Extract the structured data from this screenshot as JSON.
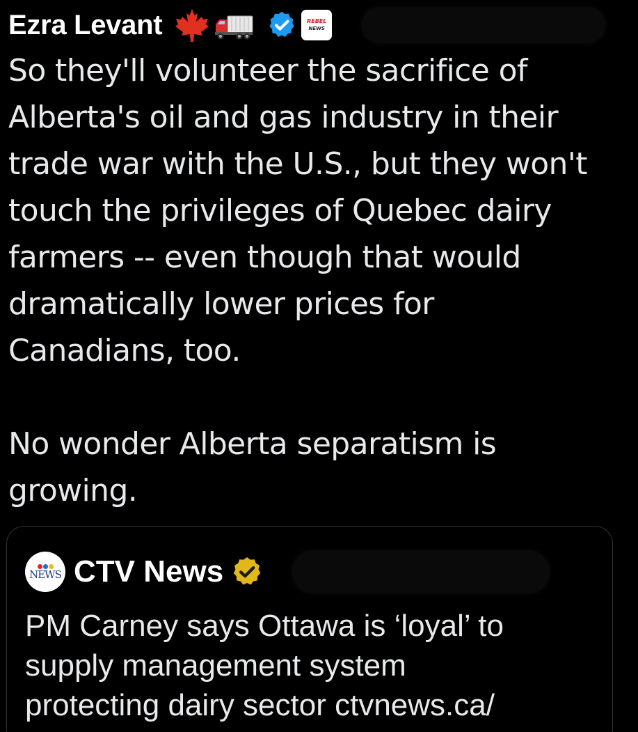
{
  "post": {
    "author": {
      "name": "Ezra Levant",
      "badges": [
        "maple-leaf-icon",
        "truck-icon",
        "verified-icon",
        "org-affiliation-badge"
      ],
      "org_badge_text": [
        "REBEL",
        "NEWS"
      ],
      "handle_redacted": true
    },
    "text": "So they'll volunteer the sacrifice of\nAlberta's oil and gas industry in their\ntrade war with the U.S., but they won't\ntouch the privileges of Quebec dairy\nfarmers -- even though that would\ndramatically lower prices for\nCanadians, too.\n\nNo wonder Alberta separatism is\ngrowing."
  },
  "quoted_post": {
    "author": {
      "name": "CTV News",
      "logo_text": "NEWS",
      "badges": [
        "gold-verified-icon"
      ],
      "handle_redacted": true
    },
    "text": "PM Carney says Ottawa is ‘loyal’ to\nsupply management system\nprotecting dairy sector ctvnews.ca/"
  },
  "colors": {
    "background": "#000000",
    "text": "#e7e9ea",
    "verified_blue": "#1d9bf0",
    "verified_gold": "#e2b719",
    "card_border": "#2f3336",
    "maple_red": "#e0301e"
  }
}
